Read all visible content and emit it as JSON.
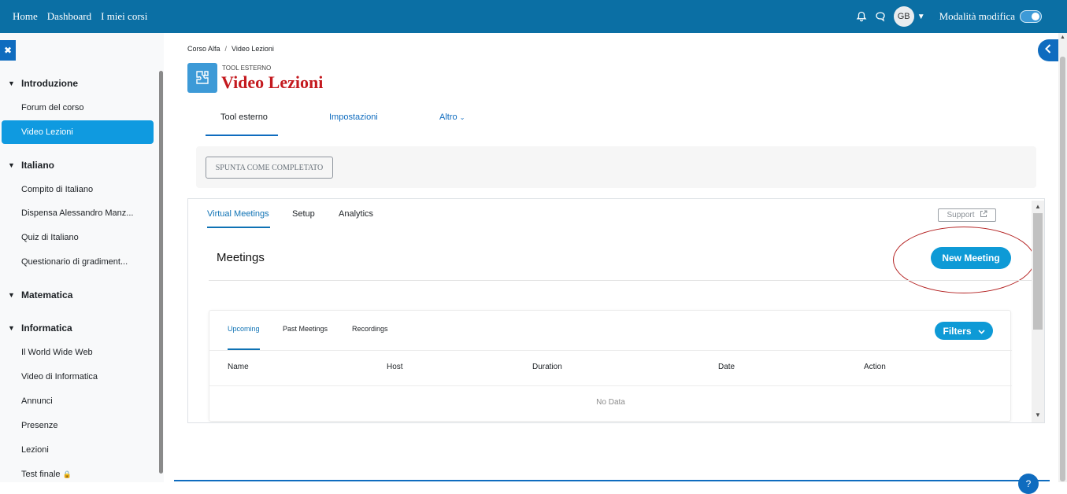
{
  "topbar": {
    "nav": [
      "Home",
      "Dashboard",
      "I miei corsi"
    ],
    "avatar_initials": "GB",
    "edit_mode_label": "Modalità modifica",
    "accent_color": "#0b6fa4"
  },
  "sidebar": {
    "sections": [
      {
        "title": "Introduzione",
        "items": [
          "Forum del corso",
          "Video Lezioni"
        ]
      },
      {
        "title": "Italiano",
        "items": [
          "Compito di Italiano",
          "Dispensa Alessandro Manz...",
          "Quiz di Italiano",
          "Questionario di gradiment..."
        ]
      },
      {
        "title": "Matematica",
        "items": []
      },
      {
        "title": "Informatica",
        "items": [
          "Il World Wide Web",
          "Video di Informatica",
          "Annunci",
          "Presenze",
          "Lezioni",
          "Test finale"
        ]
      }
    ],
    "active_item": "Video Lezioni"
  },
  "breadcrumb": [
    "Corso Alfa",
    "Video Lezioni"
  ],
  "header": {
    "kicker": "TOOL ESTERNO",
    "title": "Video Lezioni",
    "title_color": "#c41a1f"
  },
  "secondary_tabs": [
    "Tool esterno",
    "Impostazioni",
    "Altro"
  ],
  "completion_button": "SPUNTA COME COMPLETATO",
  "embed": {
    "tabs": [
      "Virtual Meetings",
      "Setup",
      "Analytics"
    ],
    "support_label": "Support",
    "meetings_title": "Meetings",
    "new_meeting_label": "New Meeting",
    "inner_tabs": [
      "Upcoming",
      "Past Meetings",
      "Recordings"
    ],
    "filters_label": "Filters",
    "columns": [
      "Name",
      "Host",
      "Duration",
      "Date",
      "Action"
    ],
    "empty_text": "No Data",
    "button_color": "#0e9ad6"
  }
}
